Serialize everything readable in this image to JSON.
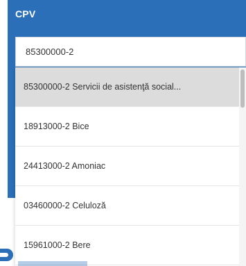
{
  "field": {
    "label": "CPV",
    "value": "85300000-2",
    "placeholder": ""
  },
  "dropdown": {
    "options": [
      {
        "label": "85300000-2 Servicii de asistenţă social...",
        "highlighted": true
      },
      {
        "label": "18913000-2 Bice",
        "highlighted": false
      },
      {
        "label": "24413000-2 Amoniac",
        "highlighted": false
      },
      {
        "label": "03460000-2 Celuloză",
        "highlighted": false
      },
      {
        "label": "15961000-2 Bere",
        "highlighted": false
      }
    ]
  },
  "colors": {
    "panel": "#2a6fb8",
    "highlight": "#dcdcdc"
  }
}
